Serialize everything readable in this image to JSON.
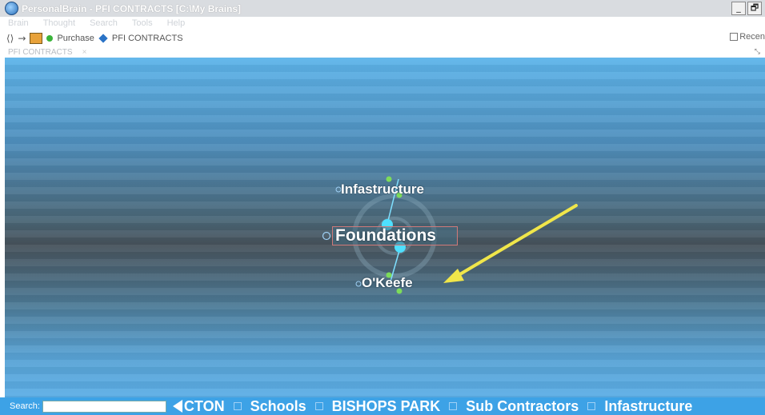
{
  "window": {
    "title": "PersonalBrain - PFI CONTRACTS [C:\\My Brains]",
    "minimize": "_",
    "restore": "🗗"
  },
  "menu": [
    "Brain",
    "Thought",
    "Search",
    "Tools",
    "Help"
  ],
  "toolbar": {
    "back_icon": "⟨⟩",
    "forward_icon": "→",
    "crumb_1": "Purchase",
    "crumb_2": "PFI CONTRACTS",
    "recent_label": "Recen"
  },
  "tabs": {
    "active": "PFI CONTRACTS",
    "close": "×"
  },
  "brain": {
    "parent": "Infastructure",
    "active": "Foundations",
    "child": "O'Keefe"
  },
  "colors": {
    "accent": "#3da2e6",
    "arrow": "#f0e64a",
    "link": "#7fe0ff",
    "node_dot": "#4fe0ff",
    "gate_dot": "#7ddc5a"
  },
  "statusbar": {
    "search_label": "Search:",
    "search_value": "",
    "plex_items": [
      "CTON",
      "Schools",
      "BISHOPS PARK",
      "Sub Contractors",
      "Infastructure"
    ]
  }
}
